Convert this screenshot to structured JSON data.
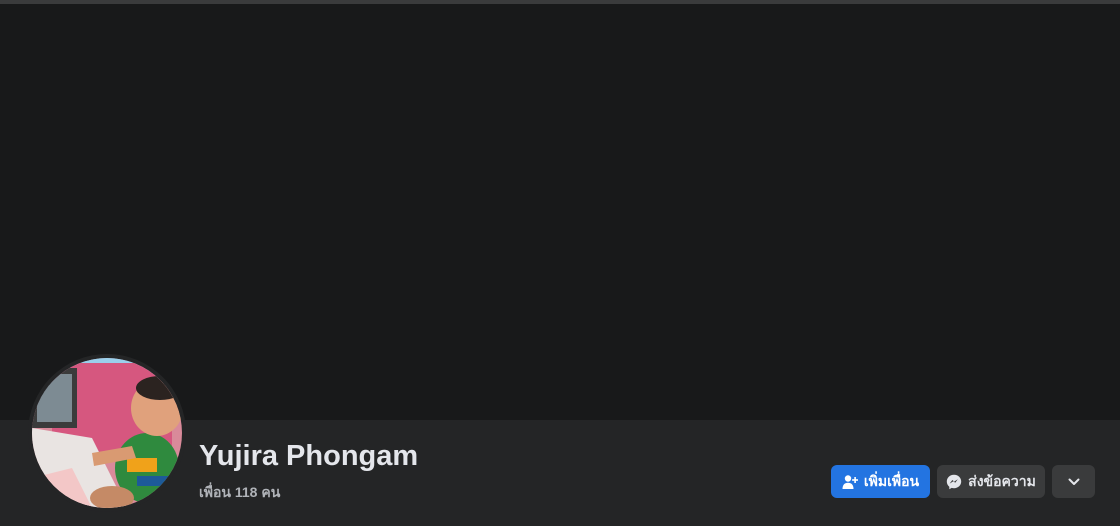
{
  "profile": {
    "name": "Yujira Phongam",
    "friends_text": "เพื่อน 118 คน"
  },
  "actions": {
    "add_friend_label": "เพิ่มเพื่อน",
    "add_friend_icon": "add-friend-icon",
    "message_label": "ส่งข้อความ",
    "message_icon": "messenger-icon",
    "more_icon": "chevron-down-icon"
  },
  "colors": {
    "cover_background": "#18191a",
    "bar_background": "#242526",
    "primary_button": "#2374e1",
    "secondary_button": "#3a3b3c",
    "name_text": "#e4e6eb",
    "secondary_text": "#b0b3b8"
  }
}
